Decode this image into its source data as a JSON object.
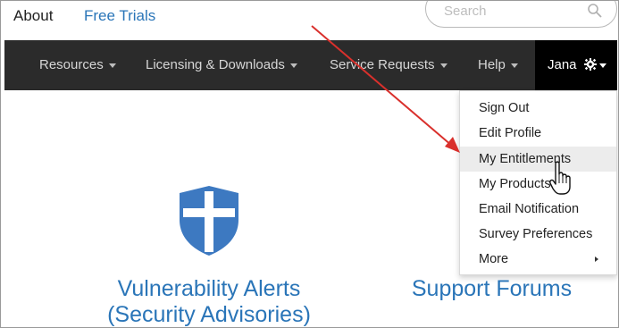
{
  "top_links": {
    "about": "About",
    "free_trials": "Free Trials"
  },
  "search": {
    "placeholder": "Search"
  },
  "navbar": {
    "items": [
      {
        "label": "Resources"
      },
      {
        "label": "Licensing & Downloads"
      },
      {
        "label": "Service Requests"
      },
      {
        "label": "Help"
      }
    ],
    "user": "Jana"
  },
  "user_menu": {
    "items": [
      {
        "label": "Sign Out"
      },
      {
        "label": "Edit Profile"
      },
      {
        "label": "My Entitlements"
      },
      {
        "label": "My Products"
      },
      {
        "label": "Email Notification"
      },
      {
        "label": "Survey Preferences"
      },
      {
        "label": "More"
      }
    ],
    "highlighted_item": "My Entitlements"
  },
  "content": {
    "vulnerability_title_line1": "Vulnerability Alerts",
    "vulnerability_title_line2": "(Security Advisories)",
    "support_forums": "Support Forums"
  },
  "colors": {
    "navbar_bg": "#2b2b2b",
    "link_blue": "#2a75b8",
    "shield_blue": "#3d79c1",
    "annotation_red": "#d9302c"
  }
}
